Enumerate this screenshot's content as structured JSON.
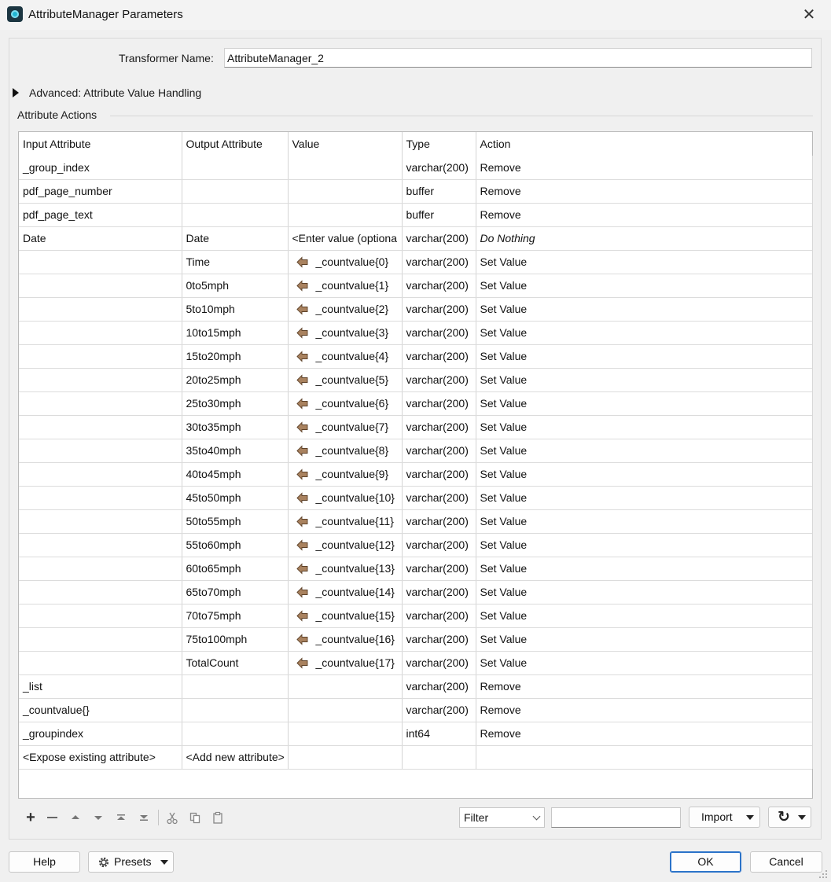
{
  "window": {
    "title": "AttributeManager Parameters",
    "close_symbol": "✕"
  },
  "transformer": {
    "label": "Transformer Name:",
    "value": "AttributeManager_2"
  },
  "advanced": {
    "label": "Advanced: Attribute Value Handling"
  },
  "attribute_actions": {
    "label": "Attribute Actions",
    "columns": [
      "Input Attribute",
      "Output Attribute",
      "Value",
      "Type",
      "Action"
    ],
    "rows": [
      {
        "input": "_group_index",
        "output": "",
        "value": "",
        "type": "varchar(200)",
        "action": "Remove"
      },
      {
        "input": "pdf_page_number",
        "output": "",
        "value": "",
        "type": "buffer",
        "action": "Remove"
      },
      {
        "input": "pdf_page_text",
        "output": "",
        "value": "",
        "type": "buffer",
        "action": "Remove"
      },
      {
        "input": "Date",
        "output": "Date",
        "value": "<Enter value (optiona",
        "type": "varchar(200)",
        "action": "Do Nothing"
      },
      {
        "input": "",
        "output": "Time",
        "value": "_countvalue{0}",
        "type": "varchar(200)",
        "action": "Set Value"
      },
      {
        "input": "",
        "output": "0to5mph",
        "value": "_countvalue{1}",
        "type": "varchar(200)",
        "action": "Set Value"
      },
      {
        "input": "",
        "output": "5to10mph",
        "value": "_countvalue{2}",
        "type": "varchar(200)",
        "action": "Set Value"
      },
      {
        "input": "",
        "output": "10to15mph",
        "value": "_countvalue{3}",
        "type": "varchar(200)",
        "action": "Set Value"
      },
      {
        "input": "",
        "output": "15to20mph",
        "value": "_countvalue{4}",
        "type": "varchar(200)",
        "action": "Set Value"
      },
      {
        "input": "",
        "output": "20to25mph",
        "value": "_countvalue{5}",
        "type": "varchar(200)",
        "action": "Set Value"
      },
      {
        "input": "",
        "output": "25to30mph",
        "value": "_countvalue{6}",
        "type": "varchar(200)",
        "action": "Set Value"
      },
      {
        "input": "",
        "output": "30to35mph",
        "value": "_countvalue{7}",
        "type": "varchar(200)",
        "action": "Set Value"
      },
      {
        "input": "",
        "output": "35to40mph",
        "value": "_countvalue{8}",
        "type": "varchar(200)",
        "action": "Set Value"
      },
      {
        "input": "",
        "output": "40to45mph",
        "value": "_countvalue{9}",
        "type": "varchar(200)",
        "action": "Set Value"
      },
      {
        "input": "",
        "output": "45to50mph",
        "value": "_countvalue{10}",
        "type": "varchar(200)",
        "action": "Set Value"
      },
      {
        "input": "",
        "output": "50to55mph",
        "value": "_countvalue{11}",
        "type": "varchar(200)",
        "action": "Set Value"
      },
      {
        "input": "",
        "output": "55to60mph",
        "value": "_countvalue{12}",
        "type": "varchar(200)",
        "action": "Set Value"
      },
      {
        "input": "",
        "output": "60to65mph",
        "value": "_countvalue{13}",
        "type": "varchar(200)",
        "action": "Set Value"
      },
      {
        "input": "",
        "output": "65to70mph",
        "value": "_countvalue{14}",
        "type": "varchar(200)",
        "action": "Set Value"
      },
      {
        "input": "",
        "output": "70to75mph",
        "value": "_countvalue{15}",
        "type": "varchar(200)",
        "action": "Set Value"
      },
      {
        "input": "",
        "output": "75to100mph",
        "value": "_countvalue{16}",
        "type": "varchar(200)",
        "action": "Set Value"
      },
      {
        "input": "",
        "output": "TotalCount",
        "value": "_countvalue{17}",
        "type": "varchar(200)",
        "action": "Set Value"
      },
      {
        "input": "_list",
        "output": "",
        "value": "",
        "type": "varchar(200)",
        "action": "Remove"
      },
      {
        "input": "_countvalue{}",
        "output": "",
        "value": "",
        "type": "varchar(200)",
        "action": "Remove"
      },
      {
        "input": "_groupindex",
        "output": "",
        "value": "",
        "type": "int64",
        "action": "Remove"
      },
      {
        "input": "<Expose existing attribute>",
        "output": "<Add new attribute>",
        "value": "",
        "type": "",
        "action": ""
      }
    ]
  },
  "toolbar": {
    "add_symbol": "+",
    "remove_symbol": "—",
    "filter_label": "Filter",
    "filter_value": "",
    "import_label": "Import",
    "refresh_symbol": "↻"
  },
  "footer": {
    "help_label": "Help",
    "presets_label": "Presets",
    "ok_label": "OK",
    "cancel_label": "Cancel"
  },
  "icons": {
    "value_link": "attribute-link-arrow-icon",
    "accent": "#2b73c9",
    "arrow_fill": "#a9825f"
  }
}
